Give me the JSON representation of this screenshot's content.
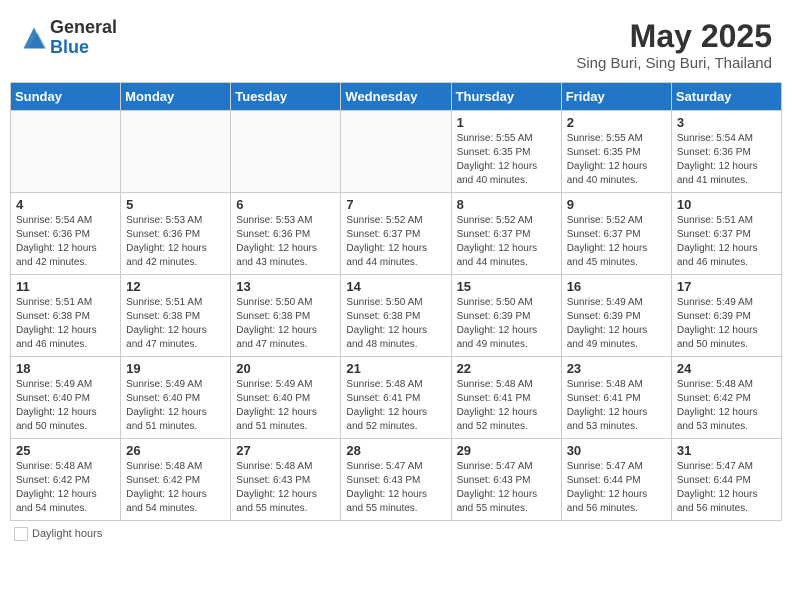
{
  "header": {
    "logo_general": "General",
    "logo_blue": "Blue",
    "month_title": "May 2025",
    "location": "Sing Buri, Sing Buri, Thailand"
  },
  "days_of_week": [
    "Sunday",
    "Monday",
    "Tuesday",
    "Wednesday",
    "Thursday",
    "Friday",
    "Saturday"
  ],
  "weeks": [
    [
      {
        "day": "",
        "info": ""
      },
      {
        "day": "",
        "info": ""
      },
      {
        "day": "",
        "info": ""
      },
      {
        "day": "",
        "info": ""
      },
      {
        "day": "1",
        "info": "Sunrise: 5:55 AM\nSunset: 6:35 PM\nDaylight: 12 hours\nand 40 minutes."
      },
      {
        "day": "2",
        "info": "Sunrise: 5:55 AM\nSunset: 6:35 PM\nDaylight: 12 hours\nand 40 minutes."
      },
      {
        "day": "3",
        "info": "Sunrise: 5:54 AM\nSunset: 6:36 PM\nDaylight: 12 hours\nand 41 minutes."
      }
    ],
    [
      {
        "day": "4",
        "info": "Sunrise: 5:54 AM\nSunset: 6:36 PM\nDaylight: 12 hours\nand 42 minutes."
      },
      {
        "day": "5",
        "info": "Sunrise: 5:53 AM\nSunset: 6:36 PM\nDaylight: 12 hours\nand 42 minutes."
      },
      {
        "day": "6",
        "info": "Sunrise: 5:53 AM\nSunset: 6:36 PM\nDaylight: 12 hours\nand 43 minutes."
      },
      {
        "day": "7",
        "info": "Sunrise: 5:52 AM\nSunset: 6:37 PM\nDaylight: 12 hours\nand 44 minutes."
      },
      {
        "day": "8",
        "info": "Sunrise: 5:52 AM\nSunset: 6:37 PM\nDaylight: 12 hours\nand 44 minutes."
      },
      {
        "day": "9",
        "info": "Sunrise: 5:52 AM\nSunset: 6:37 PM\nDaylight: 12 hours\nand 45 minutes."
      },
      {
        "day": "10",
        "info": "Sunrise: 5:51 AM\nSunset: 6:37 PM\nDaylight: 12 hours\nand 46 minutes."
      }
    ],
    [
      {
        "day": "11",
        "info": "Sunrise: 5:51 AM\nSunset: 6:38 PM\nDaylight: 12 hours\nand 46 minutes."
      },
      {
        "day": "12",
        "info": "Sunrise: 5:51 AM\nSunset: 6:38 PM\nDaylight: 12 hours\nand 47 minutes."
      },
      {
        "day": "13",
        "info": "Sunrise: 5:50 AM\nSunset: 6:38 PM\nDaylight: 12 hours\nand 47 minutes."
      },
      {
        "day": "14",
        "info": "Sunrise: 5:50 AM\nSunset: 6:38 PM\nDaylight: 12 hours\nand 48 minutes."
      },
      {
        "day": "15",
        "info": "Sunrise: 5:50 AM\nSunset: 6:39 PM\nDaylight: 12 hours\nand 49 minutes."
      },
      {
        "day": "16",
        "info": "Sunrise: 5:49 AM\nSunset: 6:39 PM\nDaylight: 12 hours\nand 49 minutes."
      },
      {
        "day": "17",
        "info": "Sunrise: 5:49 AM\nSunset: 6:39 PM\nDaylight: 12 hours\nand 50 minutes."
      }
    ],
    [
      {
        "day": "18",
        "info": "Sunrise: 5:49 AM\nSunset: 6:40 PM\nDaylight: 12 hours\nand 50 minutes."
      },
      {
        "day": "19",
        "info": "Sunrise: 5:49 AM\nSunset: 6:40 PM\nDaylight: 12 hours\nand 51 minutes."
      },
      {
        "day": "20",
        "info": "Sunrise: 5:49 AM\nSunset: 6:40 PM\nDaylight: 12 hours\nand 51 minutes."
      },
      {
        "day": "21",
        "info": "Sunrise: 5:48 AM\nSunset: 6:41 PM\nDaylight: 12 hours\nand 52 minutes."
      },
      {
        "day": "22",
        "info": "Sunrise: 5:48 AM\nSunset: 6:41 PM\nDaylight: 12 hours\nand 52 minutes."
      },
      {
        "day": "23",
        "info": "Sunrise: 5:48 AM\nSunset: 6:41 PM\nDaylight: 12 hours\nand 53 minutes."
      },
      {
        "day": "24",
        "info": "Sunrise: 5:48 AM\nSunset: 6:42 PM\nDaylight: 12 hours\nand 53 minutes."
      }
    ],
    [
      {
        "day": "25",
        "info": "Sunrise: 5:48 AM\nSunset: 6:42 PM\nDaylight: 12 hours\nand 54 minutes."
      },
      {
        "day": "26",
        "info": "Sunrise: 5:48 AM\nSunset: 6:42 PM\nDaylight: 12 hours\nand 54 minutes."
      },
      {
        "day": "27",
        "info": "Sunrise: 5:48 AM\nSunset: 6:43 PM\nDaylight: 12 hours\nand 55 minutes."
      },
      {
        "day": "28",
        "info": "Sunrise: 5:47 AM\nSunset: 6:43 PM\nDaylight: 12 hours\nand 55 minutes."
      },
      {
        "day": "29",
        "info": "Sunrise: 5:47 AM\nSunset: 6:43 PM\nDaylight: 12 hours\nand 55 minutes."
      },
      {
        "day": "30",
        "info": "Sunrise: 5:47 AM\nSunset: 6:44 PM\nDaylight: 12 hours\nand 56 minutes."
      },
      {
        "day": "31",
        "info": "Sunrise: 5:47 AM\nSunset: 6:44 PM\nDaylight: 12 hours\nand 56 minutes."
      }
    ]
  ],
  "legend": {
    "daylight_label": "Daylight hours"
  },
  "colors": {
    "header_bg": "#2176c7",
    "logo_blue": "#1a6db5"
  }
}
